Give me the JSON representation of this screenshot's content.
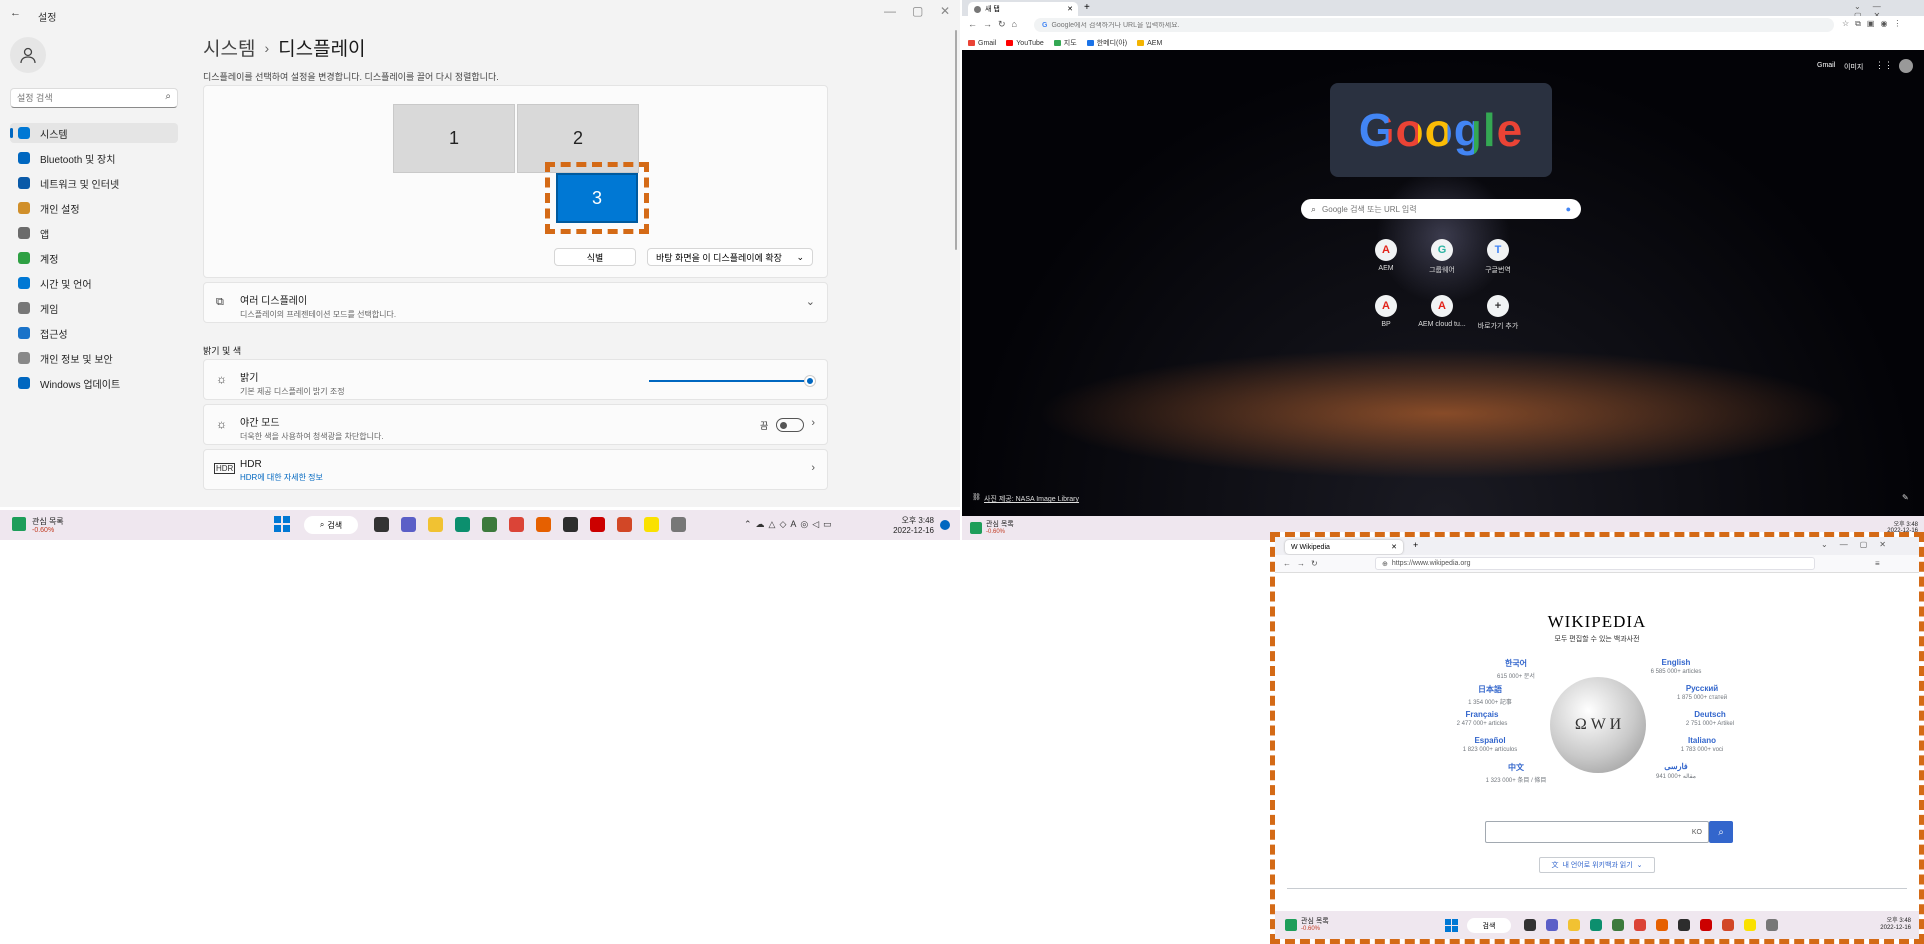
{
  "settings": {
    "title": "설정",
    "controls": {
      "minimize": "—",
      "maximize": "▢",
      "close": "✕"
    },
    "search_placeholder": "설정 검색",
    "breadcrumb": {
      "parent": "시스템",
      "separator": "›",
      "current": "디스플레이"
    },
    "description": "디스플레이를 선택하여 설정을 변경합니다. 디스플레이를 끌어 다시 정렬합니다.",
    "monitors": [
      "1",
      "2",
      "3"
    ],
    "identify_label": "식별",
    "extend_select": "바탕 화면을 이 디스플레이에 확장",
    "nav": [
      {
        "label": "시스템",
        "icon": "monitor-icon",
        "color": "#0078d4"
      },
      {
        "label": "Bluetooth 및 장치",
        "icon": "bluetooth-icon",
        "color": "#0067c0"
      },
      {
        "label": "네트워크 및 인터넷",
        "icon": "wifi-icon",
        "color": "#0a5aa8"
      },
      {
        "label": "개인 설정",
        "icon": "brush-icon",
        "color": "#d08f2a"
      },
      {
        "label": "앱",
        "icon": "apps-icon",
        "color": "#6b6b6b"
      },
      {
        "label": "계정",
        "icon": "account-icon",
        "color": "#2ea043"
      },
      {
        "label": "시간 및 언어",
        "icon": "globe-clock-icon",
        "color": "#0078d4"
      },
      {
        "label": "게임",
        "icon": "gamepad-icon",
        "color": "#777777"
      },
      {
        "label": "접근성",
        "icon": "accessibility-icon",
        "color": "#1a73c9"
      },
      {
        "label": "개인 정보 및 보안",
        "icon": "shield-icon",
        "color": "#888888"
      },
      {
        "label": "Windows 업데이트",
        "icon": "update-icon",
        "color": "#0067c0"
      }
    ],
    "multi_display": {
      "title": "여러 디스플레이",
      "subtitle": "디스플레이의 프레젠테이션 모드를 선택합니다."
    },
    "section_brightness": "밝기 및 색",
    "brightness": {
      "title": "밝기",
      "subtitle": "기본 제공 디스플레이 밝기 조정",
      "level_percent": 100
    },
    "night_light": {
      "title": "야간 모드",
      "subtitle": "더욱한 색을 사용하여 청색광을 차단합니다.",
      "state": "끔"
    },
    "hdr": {
      "title": "HDR",
      "link": "HDR에 대한 자세한 정보"
    }
  },
  "taskbar_left": {
    "widget_title": "관심 목록",
    "widget_value": "-0.60%",
    "search": "검색",
    "time": "오후 3:48",
    "date": "2022-12-16"
  },
  "chrome": {
    "tab_title": "새 탭",
    "new_tab": "+",
    "address_placeholder": "Google에서 검색하거나 URL을 입력하세요.",
    "bookmarks": [
      "Gmail",
      "YouTube",
      "지도",
      "한메디(아)",
      "AEM"
    ],
    "top_links": {
      "gmail": "Gmail",
      "images": "이미지"
    },
    "search_placeholder": "Google 검색 또는 URL 입력",
    "doodle_text": "Google",
    "shortcuts": [
      {
        "label": "AEM",
        "glyph": "A",
        "color": "#e2231a"
      },
      {
        "label": "그룹웨어",
        "glyph": "G",
        "color": "#2bb3a1"
      },
      {
        "label": "구글번역",
        "glyph": "T",
        "color": "#4285f4"
      },
      {
        "label": "BP",
        "glyph": "A",
        "color": "#e2231a"
      },
      {
        "label": "AEM cloud tu...",
        "glyph": "A",
        "color": "#e2231a"
      },
      {
        "label": "바로가기 추가",
        "glyph": "+",
        "color": "#333333"
      }
    ],
    "photo_credit": "사진 제공: NASA Image Library"
  },
  "taskbar_right": {
    "widget_title": "관심 목록",
    "widget_value": "-0.60%",
    "time": "오후 3:48",
    "date": "2022-12-16"
  },
  "firefox": {
    "tab_title": "W Wikipedia",
    "url": "https://www.wikipedia.org",
    "wordmark": "WIKIPEDIA",
    "tagline": "모두 편집할 수 있는 백과사전",
    "languages": [
      {
        "name": "한국어",
        "articles": "615 000+ 문서"
      },
      {
        "name": "English",
        "articles": "6 585 000+ articles"
      },
      {
        "name": "日本語",
        "articles": "1 354 000+ 記事"
      },
      {
        "name": "Русский",
        "articles": "1 875 000+ статей"
      },
      {
        "name": "Français",
        "articles": "2 477 000+ articles"
      },
      {
        "name": "Deutsch",
        "articles": "2 751 000+ Artikel"
      },
      {
        "name": "Español",
        "articles": "1 823 000+ artículos"
      },
      {
        "name": "Italiano",
        "articles": "1 783 000+ voci"
      },
      {
        "name": "中文",
        "articles": "1 323 000+ 条目 / 條目"
      },
      {
        "name": "فارسی",
        "articles": "941 000+ مقاله"
      }
    ],
    "lang_select": "KO",
    "read_in_language": "내 언어로 위키백과 읽기",
    "taskbar": {
      "widget_title": "관심 목록",
      "widget_value": "-0.60%",
      "search": "검색",
      "time": "오후 3:48",
      "date": "2022-12-16"
    }
  },
  "colors": {
    "accent": "#0067c0",
    "dash": "#d46a16",
    "selected_monitor": "#0078d4"
  }
}
